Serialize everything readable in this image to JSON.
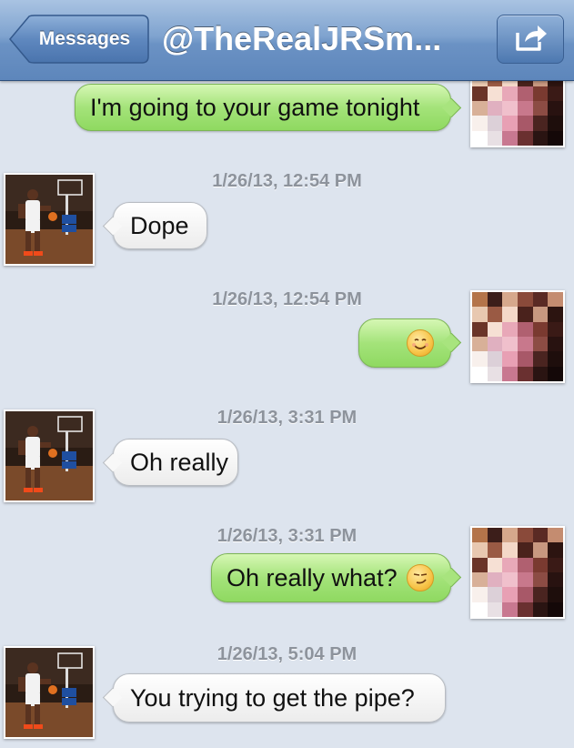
{
  "header": {
    "back_label": "Messages",
    "title": "@TheRealJRSm...",
    "share_icon": "share-icon"
  },
  "messages": [
    {
      "direction": "out",
      "text": "I'm going to your game tonight"
    },
    {
      "timestamp": "1/26/13, 12:54 PM",
      "direction": "in",
      "text": "Dope"
    },
    {
      "timestamp": "1/26/13, 12:54 PM",
      "direction": "out",
      "text": "",
      "emoji": "smiling-face-emoji"
    },
    {
      "timestamp": "1/26/13, 3:31 PM",
      "direction": "in",
      "text": "Oh really"
    },
    {
      "timestamp": "1/26/13, 3:31 PM",
      "direction": "out",
      "text": "Oh really what?",
      "emoji": "smirking-face-emoji"
    },
    {
      "timestamp": "1/26/13, 5:04 PM",
      "direction": "in",
      "text": "You trying to get the pipe?"
    }
  ],
  "colors": {
    "header": "#6b92c4",
    "outgoing_bubble": "#a4e37a",
    "incoming_bubble": "#ffffff",
    "background": "#dde4ee"
  }
}
